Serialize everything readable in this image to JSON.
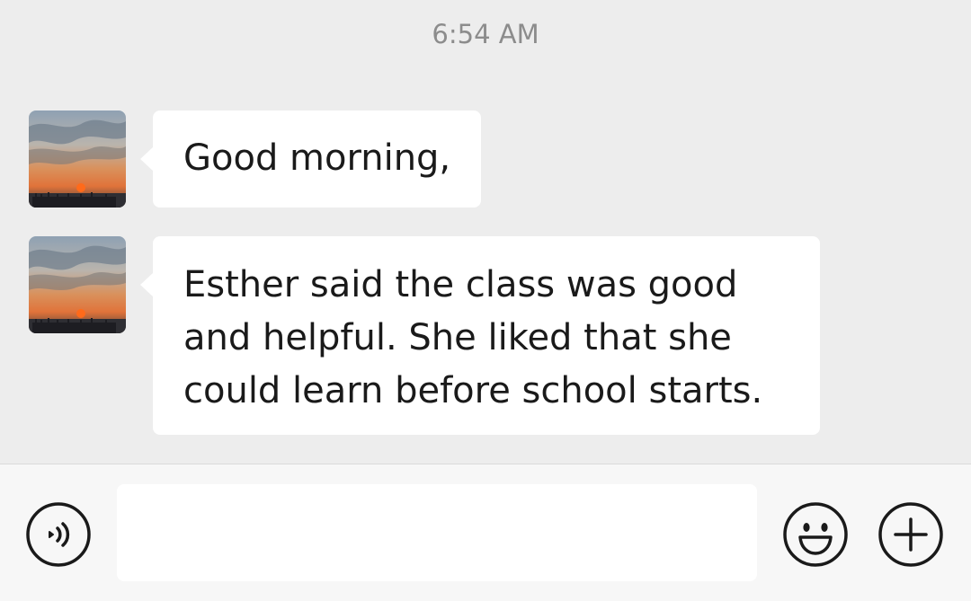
{
  "chat": {
    "timestamp": "6:54 AM",
    "messages": [
      {
        "sender_avatar": "sunset-avatar",
        "lines": [
          "Good morning,"
        ]
      },
      {
        "sender_avatar": "sunset-avatar",
        "lines": [
          "Esther said the class was good",
          "and helpful. She liked that she",
          "could learn before school starts."
        ]
      }
    ]
  },
  "input_bar": {
    "voice_icon": "voice-icon",
    "text_value": "",
    "emoji_icon": "emoji-smile-icon",
    "plus_icon": "plus-circle-icon"
  },
  "colors": {
    "chat_background": "#ededed",
    "bubble_background": "#ffffff",
    "input_bar_background": "#f7f7f7",
    "timestamp_text": "#8c8c8c",
    "icon_stroke": "#1a1a1a"
  }
}
